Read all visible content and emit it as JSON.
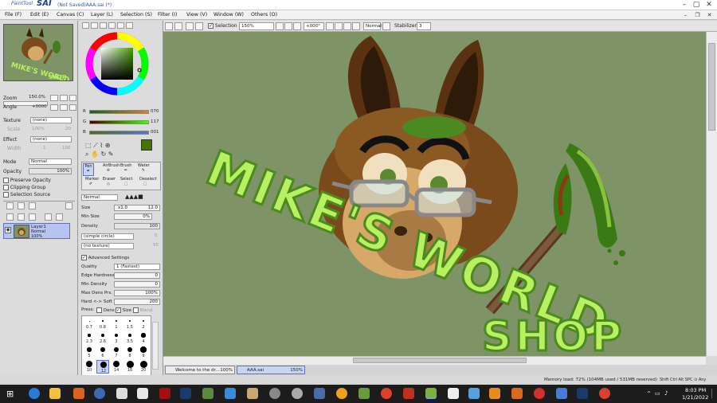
{
  "titlebar": {
    "logo_paint": "PaintTool",
    "logo_sai": "SAI",
    "doc_title": "(Not Saved)AAA.sai (*)"
  },
  "menu": [
    {
      "label": "File (F)"
    },
    {
      "label": "Edit (E)"
    },
    {
      "label": "Canvas (C)"
    },
    {
      "label": "Layer (L)"
    },
    {
      "label": "Selection (S)"
    },
    {
      "label": "Filter (I)"
    },
    {
      "label": "View (V)"
    },
    {
      "label": "Window (W)"
    },
    {
      "label": "Others (O)"
    }
  ],
  "toolbar": {
    "selection_label": "Selection",
    "zoom": "150%",
    "rotation": "+000°",
    "blend": "Normal",
    "stabilizer_label": "Stabilizer",
    "stabilizer": "3"
  },
  "navigator": {
    "zoom_label": "Zoom",
    "zoom_value": "150.0%",
    "angle_label": "Angle",
    "angle_value": "+0000",
    "texture_label": "Texture",
    "texture_value": "(none)",
    "scale_label": "Scale",
    "scale_value": "100%",
    "texture_amt": "20",
    "effect_label": "Effect",
    "effect_value": "(none)",
    "width_label": "Width",
    "width_value": "1",
    "effect_amt": "100",
    "mode_label": "Mode",
    "mode_value": "Normal",
    "opacity_label": "Opacity",
    "opacity_value": "100%",
    "opacity_fraction": 1.0,
    "preserve_opacity": "Preserve Opacity",
    "clipping_group": "Clipping Group",
    "selection_source": "Selection Source"
  },
  "layer": {
    "name": "Layer1",
    "mode": "Normal",
    "opacity": "100%"
  },
  "color": {
    "r_label": "R",
    "r_value": "070",
    "g_label": "G",
    "g_value": "117",
    "b_label": "B",
    "b_value": "001",
    "current": "#467501"
  },
  "brushes": [
    {
      "label": "Pen"
    },
    {
      "label": "AirBrush"
    },
    {
      "label": "Brush"
    },
    {
      "label": "Water"
    },
    {
      "label": "Marker"
    },
    {
      "label": "Eraser"
    },
    {
      "label": "Select"
    },
    {
      "label": "Deselect"
    }
  ],
  "tool": {
    "blend": "Normal",
    "size_label": "Size",
    "size_mult": "x1.0",
    "size_value": "12.0",
    "min_size_label": "Min Size",
    "min_size_value": "0%",
    "density_label": "Density",
    "density_value": "100",
    "shape": "(simple circle)",
    "shape_amt": "0",
    "texture": "(no texture)",
    "texture_amt": "95",
    "advanced_label": "Advanced Settings",
    "quality_label": "Quality",
    "quality_value": "1 (Fastest)",
    "edge_label": "Edge Hardness",
    "edge_value": "0",
    "min_density_label": "Min Density",
    "min_density_value": "0",
    "max_dens_label": "Max Dens Prs.",
    "max_dens_value": "100%",
    "hard_soft_label": "Hard <-> Soft",
    "hard_soft_value": "200",
    "press_label": "Press:",
    "dens_label": "Dens",
    "size_chk_label": "Size",
    "blend_chk_label": "Blend"
  },
  "brush_sizes": [
    "0.7",
    "0.8",
    "1",
    "1.5",
    "2",
    "2.3",
    "2.6",
    "3",
    "3.5",
    "4",
    "5",
    "6",
    "7",
    "8",
    "9",
    "10",
    "12",
    "14",
    "16",
    "20"
  ],
  "tabs": [
    {
      "label": "Welcome to the dr...",
      "zoom": "100%"
    },
    {
      "label": "AAA.sai",
      "zoom": "150%"
    }
  ],
  "status": {
    "memory": "Memory load: 72% (104MB used / 531MB reserved)",
    "keys": "Shift Ctrl Alt SPC ⊙ Any"
  },
  "taskbar": {
    "time": "8:03 PM",
    "date": "1/21/2022"
  },
  "artwork": {
    "text1": "MIKE'S WORLD",
    "text2": "SHOP",
    "bg": "#7e9466",
    "text_color": "#b8f060",
    "hair": "#7a4a1a",
    "face": "#d8a868"
  }
}
